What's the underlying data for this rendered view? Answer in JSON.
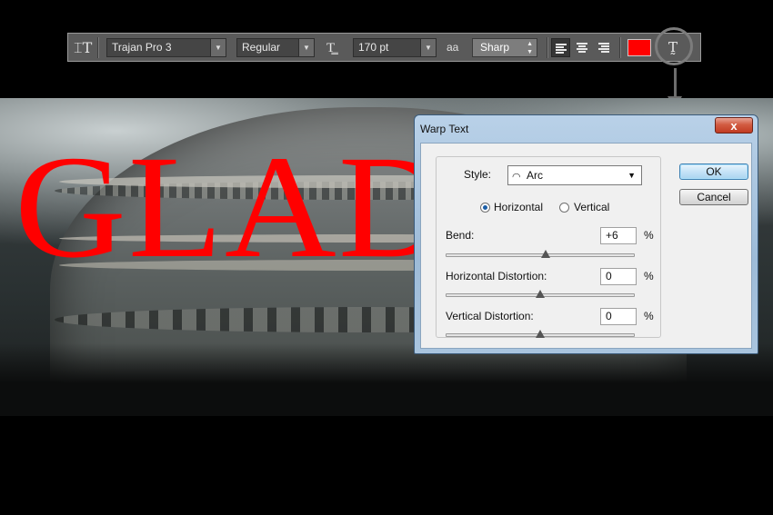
{
  "options_bar": {
    "font_family": "Trajan Pro 3",
    "font_style": "Regular",
    "font_size": "170 pt",
    "antialias_icon": "aa",
    "antialias": "Sharp",
    "text_color": "#ff0000",
    "icons": {
      "tool": "horizontal-type-tool-icon",
      "size": "font-size-icon",
      "warp": "create-warped-text-icon"
    }
  },
  "canvas": {
    "text": "GLAD",
    "text_color": "#ff0000"
  },
  "warp_dialog": {
    "title": "Warp Text",
    "close_label": "x",
    "style_label": "Style:",
    "style_value": "Arc",
    "orientation": {
      "horizontal_label": "Horizontal",
      "vertical_label": "Vertical",
      "selected": "horizontal"
    },
    "bend": {
      "label": "Bend:",
      "value": "+6",
      "unit": "%",
      "percent": 6
    },
    "horizontal_distortion": {
      "label": "Horizontal Distortion:",
      "value": "0",
      "unit": "%",
      "percent": 0
    },
    "vertical_distortion": {
      "label": "Vertical Distortion:",
      "value": "0",
      "unit": "%",
      "percent": 0
    },
    "ok_label": "OK",
    "cancel_label": "Cancel"
  }
}
